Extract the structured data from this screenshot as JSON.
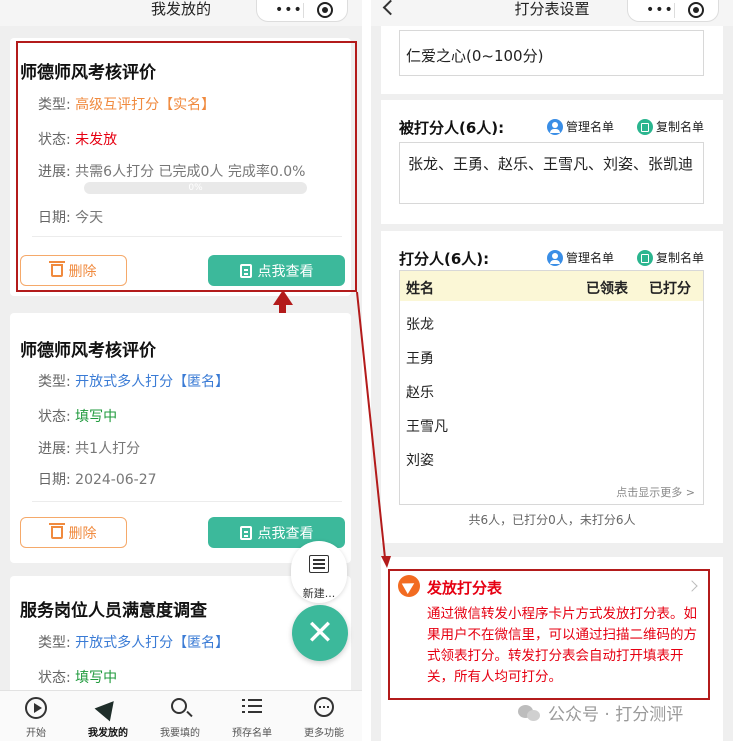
{
  "left": {
    "nav_title": "我发放的",
    "cards": [
      {
        "title": "师德师风考核评价",
        "type_label": "类型:",
        "type_value": "高级互评打分【实名】",
        "status_label": "状态:",
        "status_value": "未发放",
        "progress_label": "进展:",
        "progress_value": "共需6人打分 已完成0人 完成率0.0%",
        "progress_bar_text": "0%",
        "progress_fraction": 0,
        "date_label": "日期:",
        "date_value": "今天",
        "delete_label": "删除",
        "view_label": "点我查看"
      },
      {
        "title": "师德师风考核评价",
        "type_label": "类型:",
        "type_value": "开放式多人打分【匿名】",
        "status_label": "状态:",
        "status_value": "填写中",
        "progress_label": "进展:",
        "progress_value": "共1人打分",
        "date_label": "日期:",
        "date_value": "2024-06-27",
        "delete_label": "删除",
        "view_label": "点我查看"
      },
      {
        "title": "服务岗位人员满意度调查",
        "type_label": "类型:",
        "type_value": "开放式多人打分【匿名】",
        "status_label": "状态:",
        "status_value": "填写中"
      }
    ],
    "fab_new_label": "新建...",
    "fab_close_symbol": "✕",
    "tabs": [
      {
        "label": "开始",
        "icon": "play-circle-icon"
      },
      {
        "label": "我发放的",
        "icon": "send-icon"
      },
      {
        "label": "我要填的",
        "icon": "search-icon"
      },
      {
        "label": "预存名单",
        "icon": "list-icon"
      },
      {
        "label": "更多功能",
        "icon": "more-icon"
      }
    ],
    "active_tab": 1
  },
  "right": {
    "nav_title": "打分表设置",
    "criterion_text": "仁爱之心(0~100分)",
    "graded": {
      "title": "被打分人(6人):",
      "manage_label": "管理名单",
      "copy_label": "复制名单",
      "names_text": "张龙、王勇、赵乐、王雪凡、刘姿、张凯迪"
    },
    "graders": {
      "title": "打分人(6人):",
      "manage_label": "管理名单",
      "copy_label": "复制名单",
      "columns": [
        "姓名",
        "已领表",
        "已打分"
      ],
      "rows": [
        "张龙",
        "王勇",
        "赵乐",
        "王雪凡",
        "刘姿"
      ],
      "more_label": "点击显示更多 >",
      "summary": "共6人，已打分0人，未打分6人"
    },
    "publish": {
      "title": "发放打分表",
      "description": "通过微信转发小程序卡片方式发放打分表。如果用户不在微信里，可以通过扫描二维码的方式领表打分。转发打分表会自动打开填表开关，所有人均可打分。"
    },
    "watermark": "公众号 · 打分测评"
  },
  "colors": {
    "accent_green": "#3cb99b",
    "annotation_red": "#b31b1b",
    "text_red": "#e60012",
    "orange": "#f08a3e",
    "blue": "#3a7bd5"
  }
}
